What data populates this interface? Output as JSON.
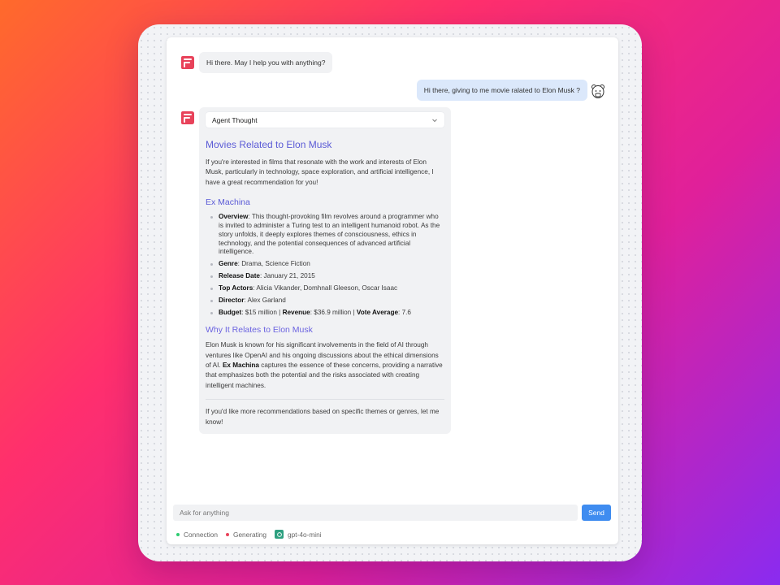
{
  "colors": {
    "accent": "#3f8cf0",
    "heading": "#5b5bd6",
    "brand": "#e8425a",
    "connection": "#2ecc71",
    "generating": "#e8425a",
    "model": "#2ea080"
  },
  "chat": {
    "bot_greeting": "Hi there. May I help you with anything?",
    "user_message": "Hi there, giving to me movie ralated to Elon Musk ?",
    "agent_thought_label": "Agent Thought",
    "answer": {
      "title": "Movies Related to Elon Musk",
      "intro": "If you're interested in films that resonate with the work and interests of Elon Musk, particularly in technology, space exploration, and artificial intelligence, I have a great recommendation for you!",
      "movie_title": "Ex Machina",
      "details": [
        {
          "label": "Overview",
          "value": ": This thought-provoking film revolves around a programmer who is invited to administer a Turing test to an intelligent humanoid robot. As the story unfolds, it deeply explores themes of consciousness, ethics in technology, and the potential consequences of advanced artificial intelligence."
        },
        {
          "label": "Genre",
          "value": ": Drama, Science Fiction"
        },
        {
          "label": "Release Date",
          "value": ": January 21, 2015"
        },
        {
          "label": "Top Actors",
          "value": ": Alicia Vikander, Domhnall Gleeson, Oscar Isaac"
        },
        {
          "label": "Director",
          "value": ": Alex Garland"
        }
      ],
      "budget": {
        "label": "Budget",
        "value": ": $15 million | ",
        "revenue_label": "Revenue",
        "revenue_value": ": $36.9 million | ",
        "vote_label": "Vote Average",
        "vote_value": ": 7.6"
      },
      "why_title": "Why It Relates to Elon Musk",
      "why_text_1": "Elon Musk is known for his significant involvements in the field of AI through ventures like OpenAI and his ongoing discussions about the ethical dimensions of AI. ",
      "why_bold": "Ex Machina",
      "why_text_2": " captures the essence of these concerns, providing a narrative that emphasizes both the potential and the risks associated with creating intelligent machines.",
      "closing": "If you'd like more recommendations based on specific themes or genres, let me know!"
    }
  },
  "input": {
    "placeholder": "Ask for anything",
    "value": ""
  },
  "send_label": "Send",
  "status": {
    "connection": "Connection",
    "generating": "Generating",
    "model": "gpt-4o-mini"
  }
}
